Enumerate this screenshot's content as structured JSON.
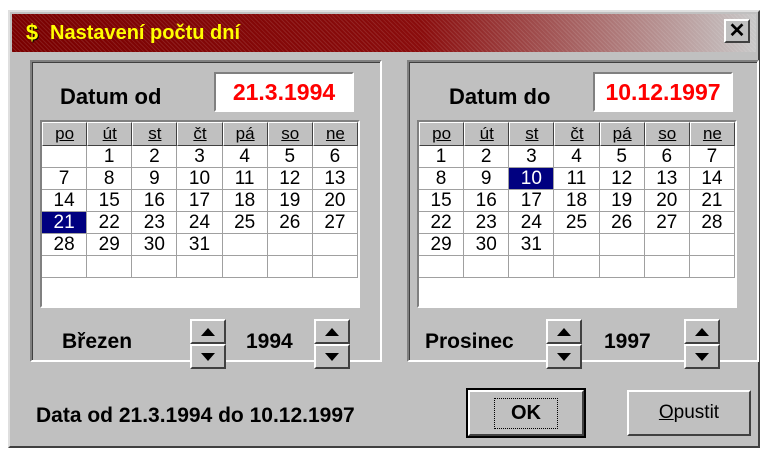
{
  "title": "Nastavení počtu dní",
  "title_icon": "$",
  "close_glyph": "✕",
  "weekdays": [
    "po",
    "út",
    "st",
    "čt",
    "pá",
    "so",
    "ne"
  ],
  "from": {
    "label": "Datum od",
    "value": "21.3.1994",
    "month": "Březen",
    "year": "1994",
    "weeks": [
      [
        "",
        "1",
        "2",
        "3",
        "4",
        "5",
        "6"
      ],
      [
        "7",
        "8",
        "9",
        "10",
        "11",
        "12",
        "13"
      ],
      [
        "14",
        "15",
        "16",
        "17",
        "18",
        "19",
        "20"
      ],
      [
        "21",
        "22",
        "23",
        "24",
        "25",
        "26",
        "27"
      ],
      [
        "28",
        "29",
        "30",
        "31",
        "",
        "",
        ""
      ],
      [
        "",
        "",
        "",
        "",
        "",
        "",
        ""
      ]
    ],
    "selected_day": "21"
  },
  "to": {
    "label": "Datum do",
    "value": "10.12.1997",
    "month": "Prosinec",
    "year": "1997",
    "weeks": [
      [
        "1",
        "2",
        "3",
        "4",
        "5",
        "6",
        "7"
      ],
      [
        "8",
        "9",
        "10",
        "11",
        "12",
        "13",
        "14"
      ],
      [
        "15",
        "16",
        "17",
        "18",
        "19",
        "20",
        "21"
      ],
      [
        "22",
        "23",
        "24",
        "25",
        "26",
        "27",
        "28"
      ],
      [
        "29",
        "30",
        "31",
        "",
        "",
        "",
        ""
      ],
      [
        "",
        "",
        "",
        "",
        "",
        "",
        ""
      ]
    ],
    "selected_day": "10"
  },
  "summary": "Data od 21.3.1994 do 10.12.1997",
  "buttons": {
    "ok": "OK",
    "cancel": "Opustit"
  },
  "colors": {
    "title_bg": "#800000",
    "title_text": "#ffff00",
    "date_value": "#ff0000",
    "selection": "#000080",
    "face": "#c0c0c0"
  }
}
